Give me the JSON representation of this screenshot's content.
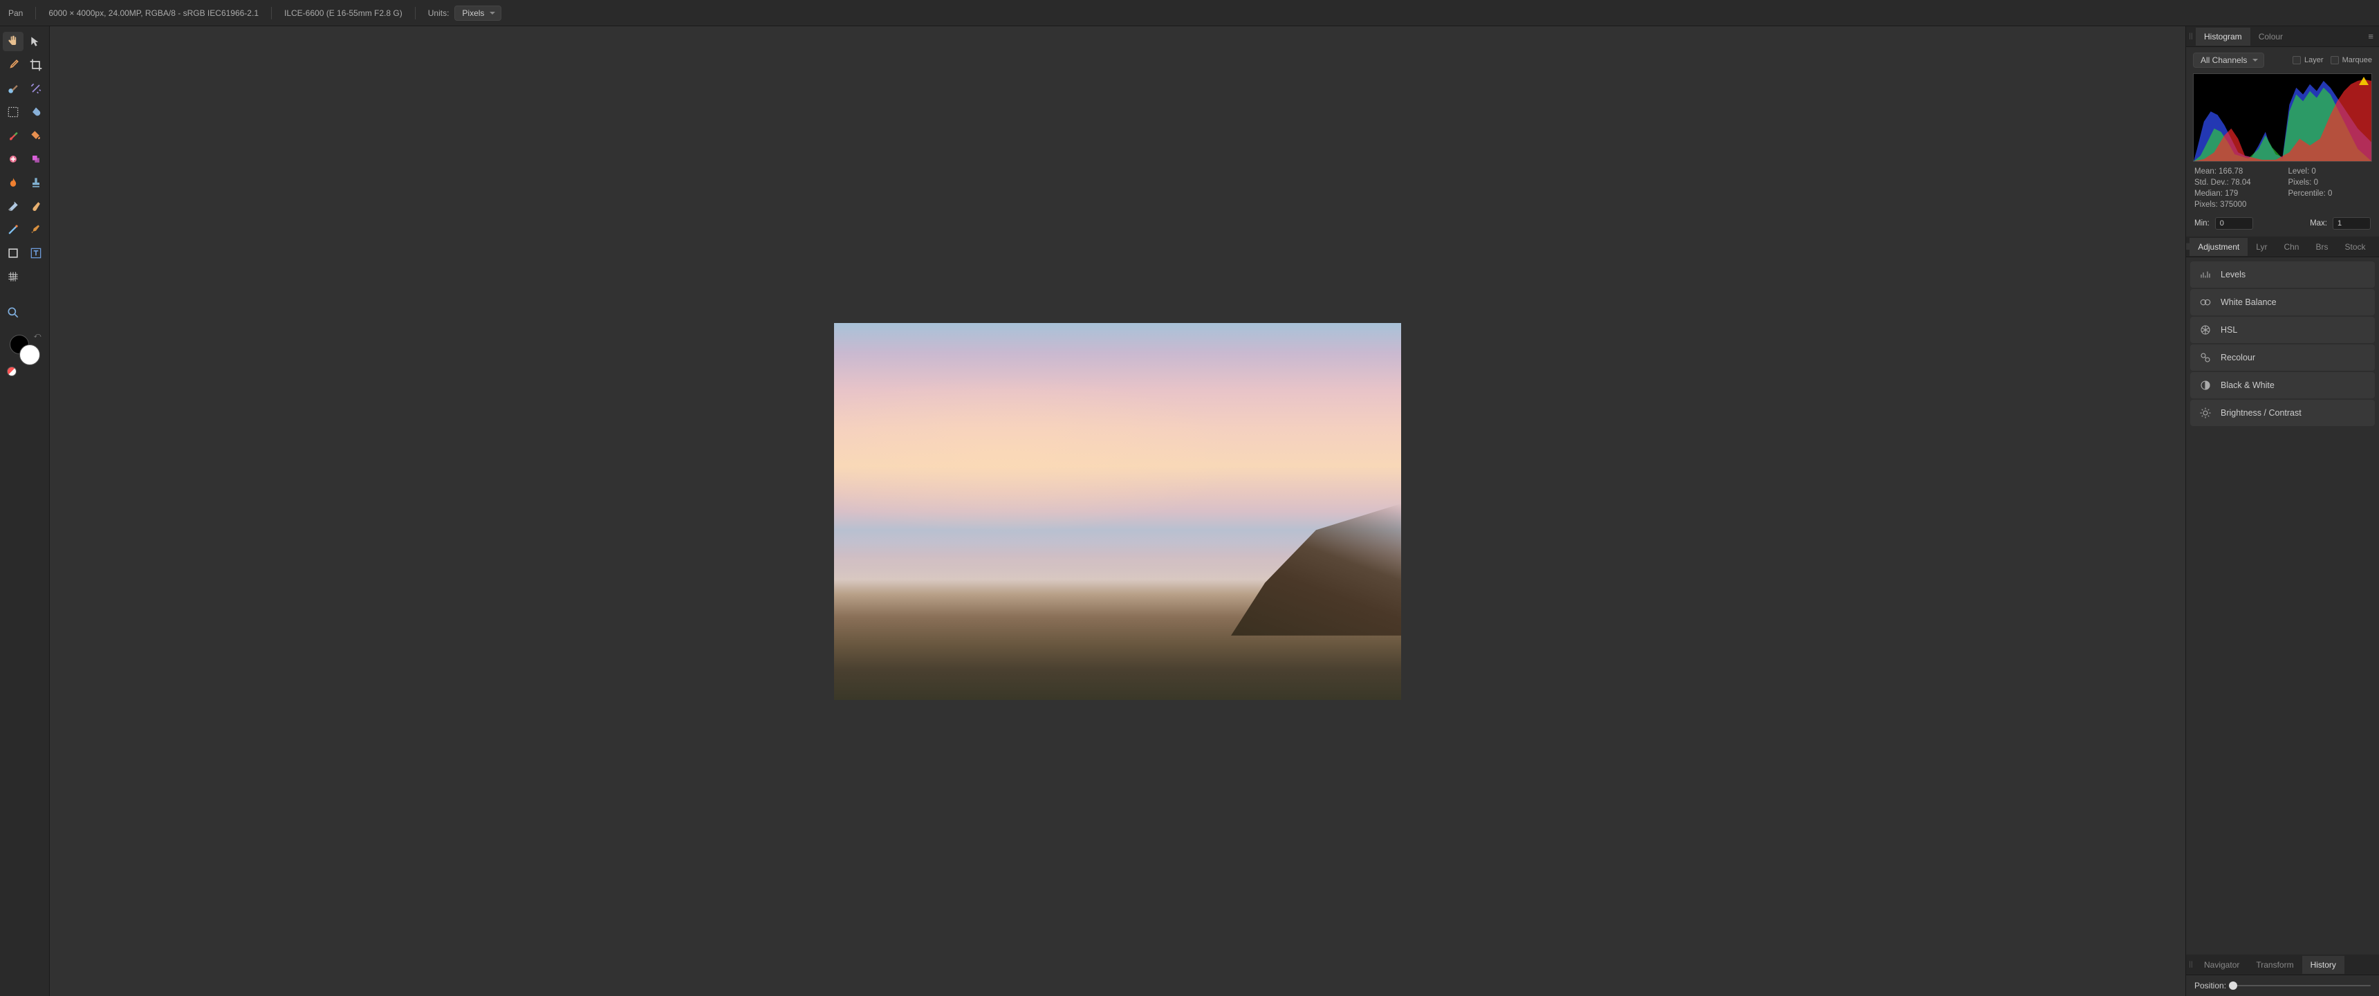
{
  "topbar": {
    "tool_name": "Pan",
    "image_info": "6000 × 4000px, 24.00MP, RGBA/8 - sRGB IEC61966-2.1",
    "camera_info": "ILCE-6600 (E 16-55mm F2.8 G)",
    "units_label": "Units:",
    "units_value": "Pixels"
  },
  "right": {
    "hist_tabs": {
      "histogram": "Histogram",
      "colour": "Colour"
    },
    "channels": "All Channels",
    "layer_chk": "Layer",
    "marquee_chk": "Marquee",
    "stats": {
      "mean": "Mean: 166.78",
      "stddev": "Std. Dev.: 78.04",
      "median": "Median: 179",
      "pixels": "Pixels: 375000",
      "level": "Level: 0",
      "pixelsR": "Pixels: 0",
      "percentile": "Percentile: 0"
    },
    "min_label": "Min:",
    "min_value": "0",
    "max_label": "Max:",
    "max_value": "1",
    "adj_tabs": {
      "adjustment": "Adjustment",
      "lyr": "Lyr",
      "chn": "Chn",
      "brs": "Brs",
      "stock": "Stock"
    },
    "adjustments": {
      "levels": "Levels",
      "white_balance": "White Balance",
      "hsl": "HSL",
      "recolour": "Recolour",
      "black_white": "Black & White",
      "brightness_contrast": "Brightness / Contrast"
    },
    "nav_tabs": {
      "navigator": "Navigator",
      "transform": "Transform",
      "history": "History"
    },
    "position_label": "Position:"
  }
}
